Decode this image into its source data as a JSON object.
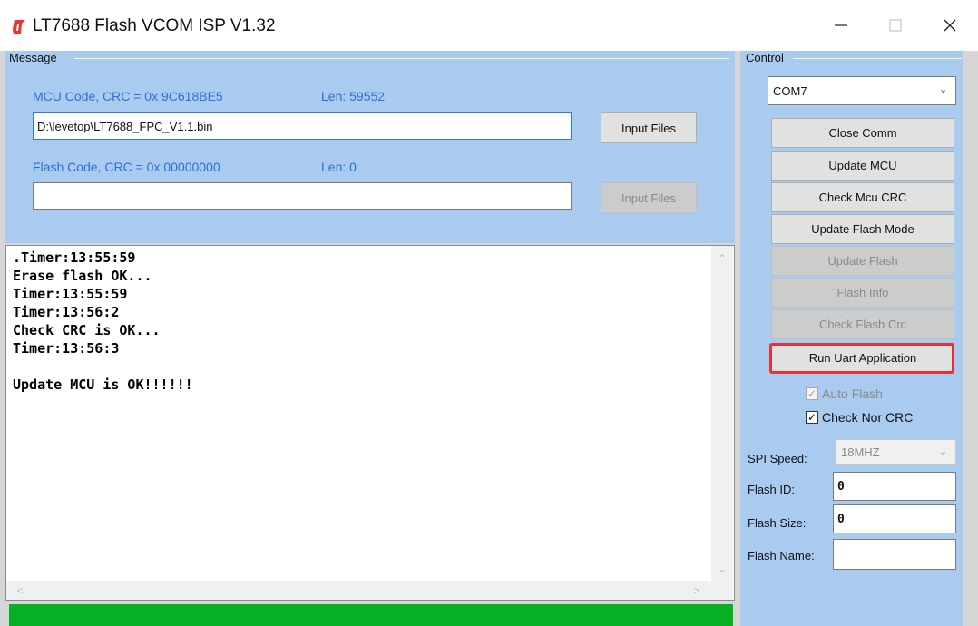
{
  "window": {
    "title": "LT7688 Flash VCOM ISP V1.32",
    "app_icon": "lt-logo-icon",
    "controls": [
      "minimize-icon",
      "maximize-icon",
      "close-icon"
    ]
  },
  "message": {
    "group_label": "Message",
    "mcu_code_label": "MCU Code, CRC = 0x 9C618BE5",
    "mcu_len_label": "Len:  59552",
    "mcu_file_value": "D:\\levetop\\LT7688_FPC_V1.1.bin",
    "mcu_input_button": "Input Files",
    "flash_code_label": "Flash Code, CRC = 0x 00000000",
    "flash_len_label": "Len:  0",
    "flash_file_value": "",
    "flash_input_button": "Input Files"
  },
  "log": {
    "lines": [
      ".Timer:13:55:59",
      "Erase flash OK...",
      "Timer:13:55:59",
      "Timer:13:56:2",
      "Check CRC is OK...",
      "Timer:13:56:3",
      "",
      "Update MCU is OK!!!!!!"
    ]
  },
  "progress": {
    "value": 1.0,
    "color": "#06b025"
  },
  "control": {
    "group_label": "Control",
    "com_port": "COM7",
    "buttons": [
      {
        "label": "Close Comm",
        "enabled": true
      },
      {
        "label": "Update MCU",
        "enabled": true
      },
      {
        "label": "Check Mcu CRC",
        "enabled": true
      },
      {
        "label": "Update Flash Mode",
        "enabled": true
      },
      {
        "label": "Update Flash",
        "enabled": false
      },
      {
        "label": "Flash Info",
        "enabled": false
      },
      {
        "label": "Check Flash Crc",
        "enabled": false
      },
      {
        "label": "Run Uart Application",
        "enabled": true
      }
    ],
    "auto_flash": {
      "label": "Auto Flash",
      "checked": true,
      "enabled": false
    },
    "check_nor_crc": {
      "label": "Check Nor CRC",
      "checked": true,
      "enabled": true
    },
    "spi_speed_label": "SPI Speed:",
    "spi_speed_value": "18MHZ",
    "flash_id_label": "Flash ID:",
    "flash_id_value": "0",
    "flash_size_label": "Flash Size:",
    "flash_size_value": "0",
    "flash_name_label": "Flash Name:",
    "flash_name_value": ""
  },
  "colors": {
    "panel_bg": "#a9cbf0",
    "label_blue": "#2d6fd8",
    "highlight_red": "#e53333"
  }
}
